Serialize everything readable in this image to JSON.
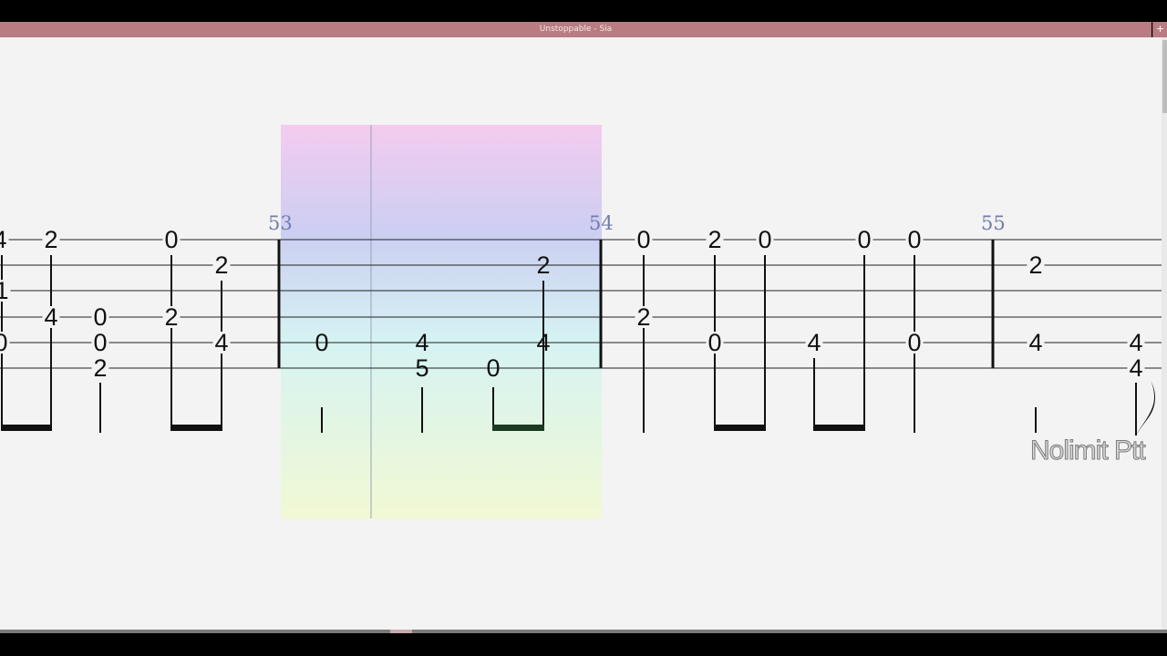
{
  "window": {
    "title": "Unstoppable - Sia",
    "plus_label": "+"
  },
  "tab": {
    "measure_numbers": [
      {
        "label": "53"
      },
      {
        "label": "54"
      },
      {
        "label": "55"
      }
    ],
    "notes": [
      {
        "fret": "4",
        "string": 1
      },
      {
        "fret": "2",
        "string": 1
      },
      {
        "fret": "1",
        "string": 3
      },
      {
        "fret": "4",
        "string": 4
      },
      {
        "fret": "0",
        "string": 5
      },
      {
        "fret": "0",
        "string": 4
      },
      {
        "fret": "0",
        "string": 5
      },
      {
        "fret": "2",
        "string": 6
      },
      {
        "fret": "0",
        "string": 1
      },
      {
        "fret": "2",
        "string": 4
      },
      {
        "fret": "2",
        "string": 2
      },
      {
        "fret": "4",
        "string": 5
      },
      {
        "fret": "0",
        "string": 5
      },
      {
        "fret": "4",
        "string": 5
      },
      {
        "fret": "5",
        "string": 6
      },
      {
        "fret": "0",
        "string": 6
      },
      {
        "fret": "2",
        "string": 2
      },
      {
        "fret": "4",
        "string": 5
      },
      {
        "fret": "0",
        "string": 1
      },
      {
        "fret": "2",
        "string": 4
      },
      {
        "fret": "2",
        "string": 1
      },
      {
        "fret": "0",
        "string": 5
      },
      {
        "fret": "0",
        "string": 1
      },
      {
        "fret": "4",
        "string": 5
      },
      {
        "fret": "0",
        "string": 1
      },
      {
        "fret": "0",
        "string": 1
      },
      {
        "fret": "0",
        "string": 5
      },
      {
        "fret": "2",
        "string": 2
      },
      {
        "fret": "4",
        "string": 5
      },
      {
        "fret": "4",
        "string": 5
      },
      {
        "fret": "4",
        "string": 6
      }
    ],
    "watermark": "Nolimit Ptt"
  }
}
